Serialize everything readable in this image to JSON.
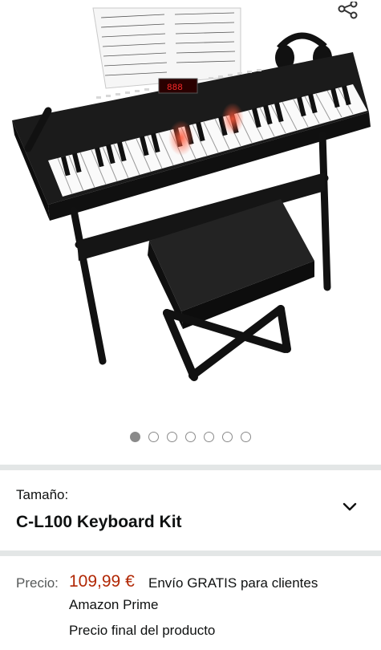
{
  "gallery": {
    "image_alt": "",
    "dots_count": 7,
    "active_dot": 0
  },
  "size": {
    "label": "Tamaño:",
    "value": "C-L100 Keyboard Kit"
  },
  "price": {
    "label": "Precio:",
    "amount": "109,99 €",
    "shipping_line1": "Envío GRATIS para clientes",
    "shipping_line2": "Amazon Prime",
    "final_note": "Precio final del producto"
  },
  "icons": {
    "share": "share-icon",
    "chevron": "chevron-down-icon"
  },
  "colors": {
    "price": "#b12704",
    "divider": "#e3e6e6",
    "text": "#0f1111",
    "muted": "#565959"
  }
}
